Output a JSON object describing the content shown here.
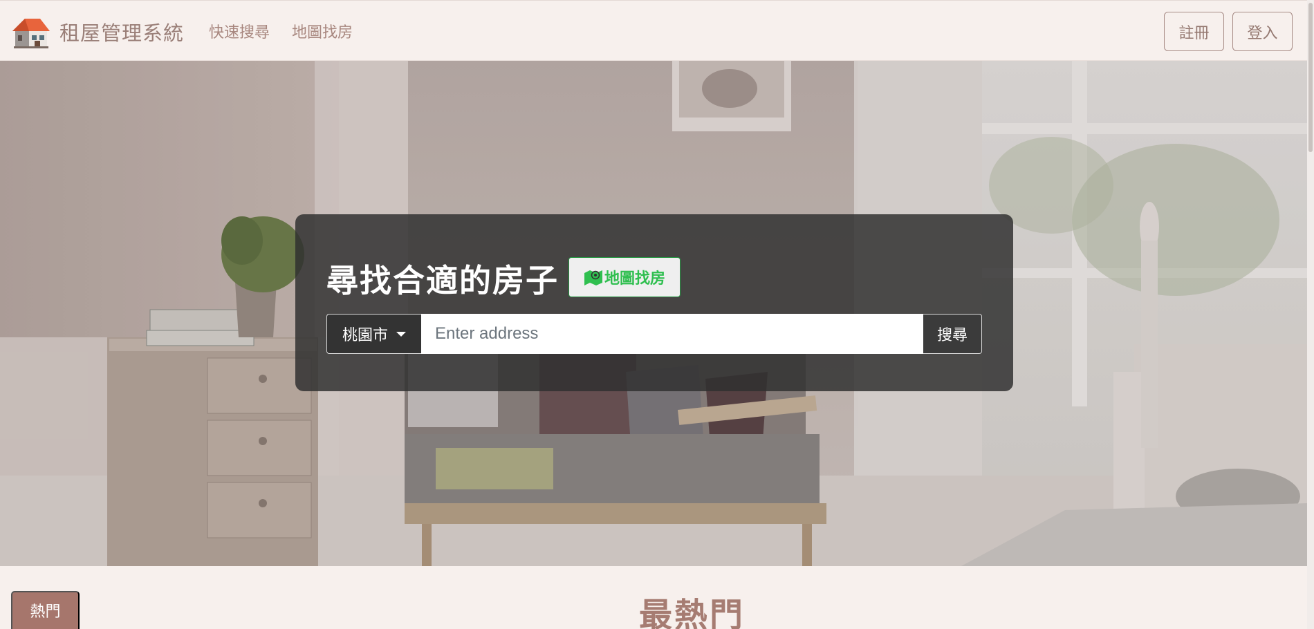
{
  "brand": {
    "title": "租屋管理系統"
  },
  "nav": {
    "links": [
      {
        "label": "快速搜尋"
      },
      {
        "label": "地圖找房"
      }
    ]
  },
  "auth": {
    "register_label": "註冊",
    "login_label": "登入"
  },
  "hero": {
    "heading": "尋找合適的房子",
    "map_button_label": "地圖找房",
    "city_select": {
      "value": "桃園市"
    },
    "address_input": {
      "placeholder": "Enter address",
      "value": ""
    },
    "search_button_label": "搜尋"
  },
  "popular": {
    "badge_label": "熱門",
    "title": "最熱門"
  },
  "colors": {
    "accent": "#a6766c",
    "map_green": "#2fbf4f",
    "navbar_bg": "#f7f0ed",
    "panel_bg": "#303030"
  },
  "icons": [
    "house-logo-icon",
    "map-marker-icon",
    "caret-down-icon"
  ]
}
